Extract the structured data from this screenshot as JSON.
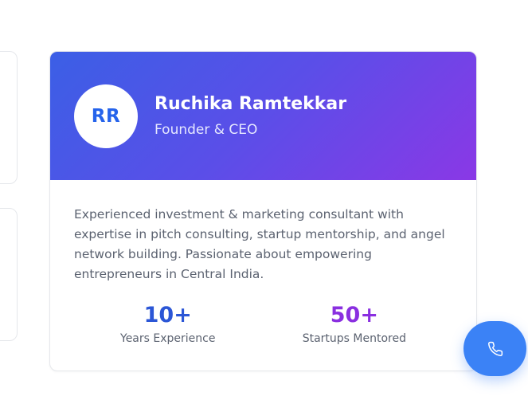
{
  "profile": {
    "initials": "RR",
    "name": "Ruchika Ramtekkar",
    "role": "Founder & CEO",
    "bio": "Experienced investment & marketing consultant with expertise in pitch consulting, startup mentorship, and angel network building. Passionate about empowering entrepreneurs in Central India.",
    "stats": [
      {
        "value": "10+",
        "label": "Years Experience",
        "color": "#2b56d6"
      },
      {
        "value": "50+",
        "label": "Startups Mentored",
        "color": "#8a2fe0"
      }
    ]
  },
  "theme": {
    "header_gradient_start": "#3b5fe6",
    "header_gradient_end": "#8a38e6",
    "fab_color": "#3b82f6"
  },
  "fab": {
    "icon": "phone-icon"
  }
}
